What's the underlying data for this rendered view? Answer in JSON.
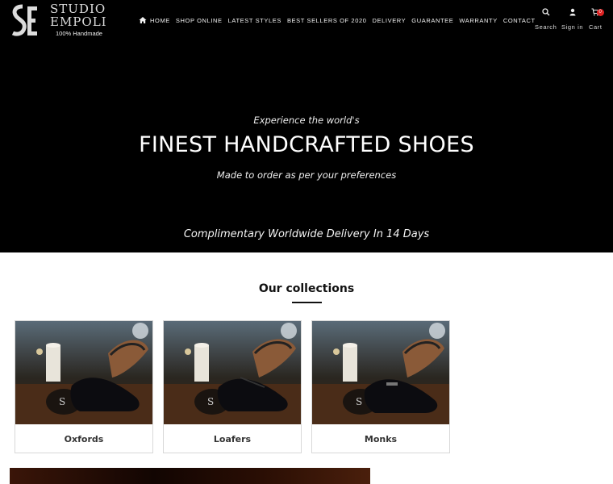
{
  "brand": {
    "name_line1": "STUDIO",
    "name_line2": "EMPOLI",
    "tagline": "100% Handmade"
  },
  "nav": {
    "items": [
      {
        "label": "HOME",
        "icon": "home-icon"
      },
      {
        "label": "SHOP ONLINE"
      },
      {
        "label": "LATEST STYLES"
      },
      {
        "label": "BEST SELLERS OF 2020"
      },
      {
        "label": "DELIVERY"
      },
      {
        "label": "GUARANTEE"
      },
      {
        "label": "WARRANTY"
      },
      {
        "label": "CONTACT"
      }
    ]
  },
  "utility": {
    "search_label": "Search",
    "signin_label": "Sign in",
    "cart_label": "Cart",
    "cart_count": "0"
  },
  "hero": {
    "pre": "Experience the world's",
    "title": "FINEST HANDCRAFTED SHOES",
    "subtitle": "Made to order as per your preferences",
    "delivery": "Complimentary Worldwide Delivery In 14 Days"
  },
  "collections": {
    "title": "Our collections",
    "items": [
      {
        "label": "Oxfords"
      },
      {
        "label": "Loafers"
      },
      {
        "label": "Monks"
      }
    ]
  },
  "colors": {
    "header_bg": "#000000",
    "accent": "#111111",
    "badge": "#dd2222"
  }
}
